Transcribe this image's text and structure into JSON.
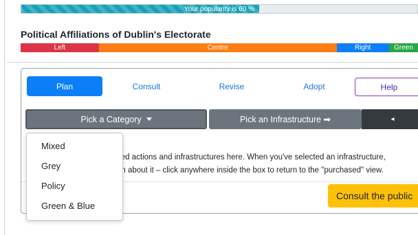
{
  "popularity": {
    "label": "Your popularity is 60 %",
    "value_percent": 60,
    "color": "#17a2b8"
  },
  "affiliations": {
    "title": "Political Affiliations of Dublin's Electorate",
    "segments": [
      {
        "label": "Left",
        "share_percent": 19.7,
        "color": "#dc3545"
      },
      {
        "label": "Centre",
        "share_percent": 59.8,
        "color": "#fd7e14"
      },
      {
        "label": "Right",
        "share_percent": 13.2,
        "color": "#0d7ff6"
      },
      {
        "label": "Green",
        "share_percent": 7.3,
        "color": "#28a745"
      }
    ]
  },
  "phases": {
    "plan": "Plan",
    "consult": "Consult",
    "revise": "Revise",
    "adopt": "Adopt",
    "help": "Help",
    "active": "Plan"
  },
  "pickers": {
    "category": "Pick a Category",
    "infrastructure": "Pick an Infrastructure ➡",
    "back": "◂"
  },
  "description": {
    "line1": "sed actions and infrastructures here. When you've selected an infrastructure,",
    "line2": "on about it – click anywhere inside the box to return to the \"purchased\" view."
  },
  "consult_public": "Consult the public",
  "category_menu": {
    "items": [
      "Mixed",
      "Grey",
      "Policy",
      "Green & Blue"
    ]
  },
  "colors": {
    "primary": "#0d7ff6",
    "secondary": "#6c757d",
    "dark": "#343a40",
    "warning": "#ffc107",
    "help_border": "#7c3bd2"
  }
}
